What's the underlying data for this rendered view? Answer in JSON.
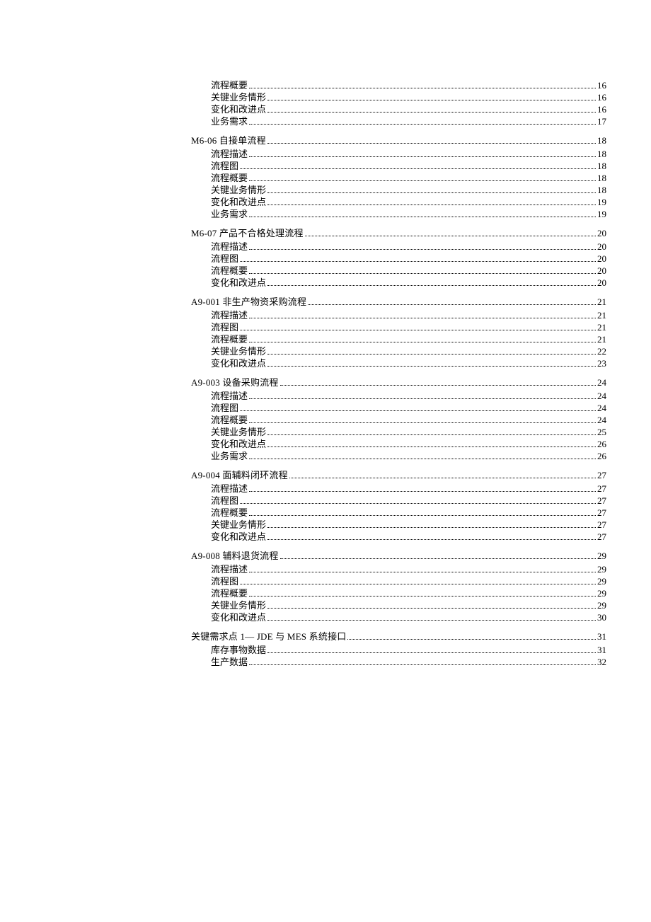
{
  "toc": [
    {
      "title": "",
      "page": "",
      "children": [
        {
          "title": "流程概要",
          "page": "16"
        },
        {
          "title": "关键业务情形",
          "page": "16"
        },
        {
          "title": "变化和改进点",
          "page": "16"
        },
        {
          "title": "业务需求",
          "page": "17"
        }
      ]
    },
    {
      "title": "M6-06   自接单流程",
      "page": "18",
      "children": [
        {
          "title": "流程描述",
          "page": "18"
        },
        {
          "title": "流程图",
          "page": "18"
        },
        {
          "title": "流程概要",
          "page": "18"
        },
        {
          "title": "关键业务情形",
          "page": "18"
        },
        {
          "title": "变化和改进点",
          "page": "19"
        },
        {
          "title": "业务需求",
          "page": "19"
        }
      ]
    },
    {
      "title": "M6-07  产品不合格处理流程",
      "page": "20",
      "children": [
        {
          "title": "流程描述",
          "page": "20"
        },
        {
          "title": "流程图",
          "page": "20"
        },
        {
          "title": "流程概要",
          "page": "20"
        },
        {
          "title": "变化和改进点",
          "page": "20"
        }
      ]
    },
    {
      "title": "A9-001  非生产物资采购流程",
      "page": "21",
      "children": [
        {
          "title": "流程描述",
          "page": "21"
        },
        {
          "title": "流程图",
          "page": "21"
        },
        {
          "title": "流程概要",
          "page": "21"
        },
        {
          "title": "关键业务情形",
          "page": "22"
        },
        {
          "title": "变化和改进点",
          "page": "23"
        }
      ]
    },
    {
      "title": "A9-003  设备采购流程",
      "page": "24",
      "children": [
        {
          "title": "流程描述",
          "page": "24"
        },
        {
          "title": "流程图",
          "page": "24"
        },
        {
          "title": "流程概要",
          "page": "24"
        },
        {
          "title": "关键业务情形",
          "page": "25"
        },
        {
          "title": "变化和改进点",
          "page": "26"
        },
        {
          "title": "业务需求",
          "page": "26"
        }
      ]
    },
    {
      "title": "A9-004  面辅料闭环流程",
      "page": "27",
      "children": [
        {
          "title": "流程描述",
          "page": "27"
        },
        {
          "title": "流程图",
          "page": "27"
        },
        {
          "title": "流程概要",
          "page": "27"
        },
        {
          "title": "关键业务情形",
          "page": "27"
        },
        {
          "title": "变化和改进点",
          "page": "27"
        }
      ]
    },
    {
      "title": "A9-008  辅料退货流程",
      "page": "29",
      "children": [
        {
          "title": "流程描述",
          "page": "29"
        },
        {
          "title": "流程图",
          "page": "29"
        },
        {
          "title": "流程概要",
          "page": "29"
        },
        {
          "title": "关键业务情形",
          "page": "29"
        },
        {
          "title": "变化和改进点",
          "page": "30"
        }
      ]
    },
    {
      "title": "关键需求点   1— JDE 与 MES 系统接口",
      "page": "31",
      "children": [
        {
          "title": "库存事物数据",
          "page": "31"
        },
        {
          "title": "生产数据",
          "page": "32"
        }
      ]
    }
  ]
}
